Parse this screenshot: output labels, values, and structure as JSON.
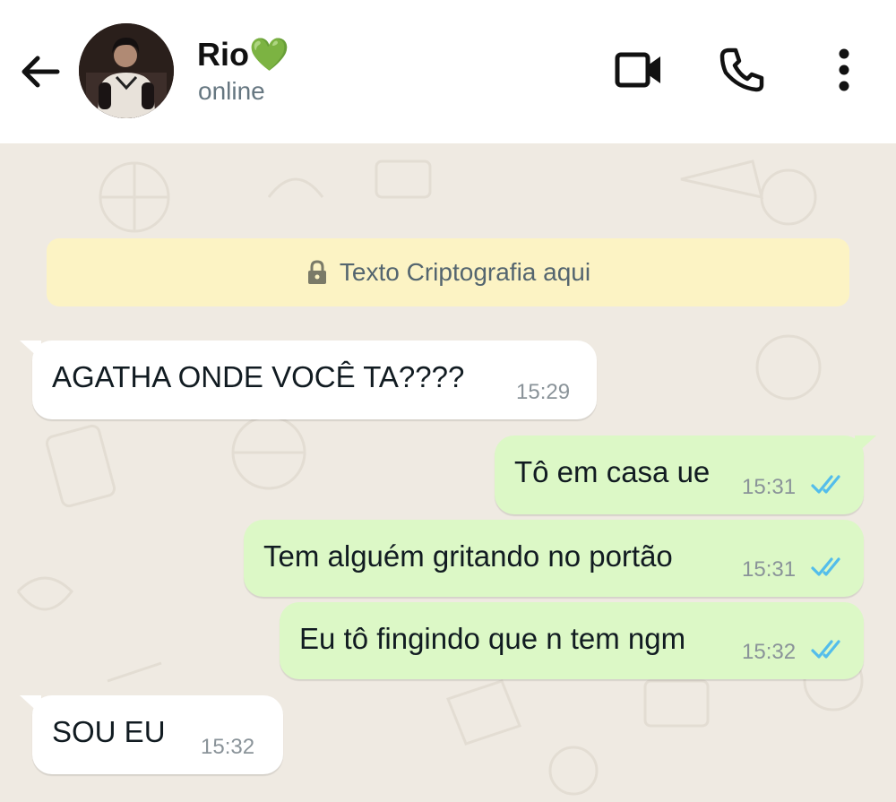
{
  "header": {
    "contact_name": "Rio",
    "contact_emoji": "💚",
    "status": "online",
    "icons": {
      "back": "arrow-left-icon",
      "video": "video-call-icon",
      "voice": "phone-icon",
      "menu": "more-vertical-icon"
    }
  },
  "chat": {
    "encryption_notice": "Texto Criptografia aqui",
    "messages": [
      {
        "direction": "incoming",
        "text": "AGATHA ONDE VOCÊ TA????",
        "time": "15:29"
      },
      {
        "direction": "outgoing",
        "text": "Tô em casa ue",
        "time": "15:31",
        "status": "read"
      },
      {
        "direction": "outgoing",
        "text": "Tem alguém gritando no portão",
        "time": "15:31",
        "status": "read"
      },
      {
        "direction": "outgoing",
        "text": "Eu tô fingindo que n tem ngm",
        "time": "15:32",
        "status": "read"
      },
      {
        "direction": "incoming",
        "text": "SOU EU",
        "time": "15:32"
      }
    ]
  },
  "colors": {
    "chat_background": "#efeae2",
    "outgoing_bubble": "#dcf8c6",
    "incoming_bubble": "#ffffff",
    "encryption_banner": "#fcf3c4",
    "read_ticks": "#53bdeb",
    "online_heart": "#2dbe4f"
  }
}
